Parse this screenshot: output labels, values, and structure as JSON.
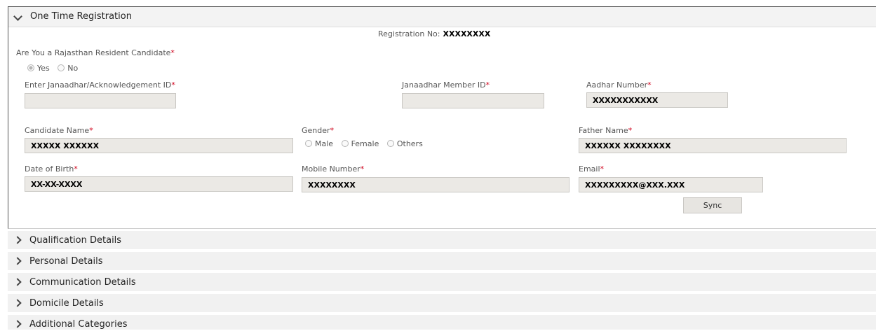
{
  "main_section": {
    "title": "One Time Registration",
    "registration_label": "Registration No:",
    "registration_value": "XXXXXXXX",
    "resident_question": "Are You a Rajasthan Resident Candidate",
    "resident_options": [
      "Yes",
      "No"
    ],
    "resident_selected": "Yes",
    "required_mark": "*",
    "janaadhar_id": {
      "label": "Enter Janaadhar/Acknowledgement ID",
      "value": ""
    },
    "janaadhar_member_id": {
      "label": "Janaadhar Member ID",
      "value": ""
    },
    "aadhar_number": {
      "label": "Aadhar Number",
      "value": "XXXXXXXXXXX"
    },
    "candidate_name": {
      "label": "Candidate Name",
      "value": "XXXXX XXXXXX"
    },
    "gender": {
      "label": "Gender",
      "options": [
        "Male",
        "Female",
        "Others"
      ]
    },
    "father_name": {
      "label": "Father Name",
      "value": "XXXXXX XXXXXXXX"
    },
    "date_of_birth": {
      "label": "Date of Birth",
      "value": "XX-XX-XXXX"
    },
    "mobile_number": {
      "label": "Mobile Number",
      "value": "XXXXXXXX"
    },
    "email": {
      "label": "Email",
      "value": "XXXXXXXXX@XXX.XXX"
    },
    "sync_label": "Sync"
  },
  "collapsed_sections": [
    "Qualification Details",
    "Personal Details",
    "Communication Details",
    "Domicile Details",
    "Additional Categories"
  ],
  "colors": {
    "required": "#d0021b",
    "field_background": "#ebe9e5",
    "section_background": "#f1f1f1"
  }
}
